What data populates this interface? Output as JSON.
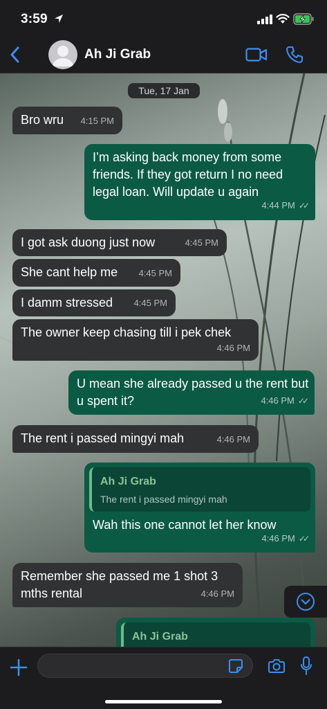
{
  "status_bar": {
    "time": "3:59"
  },
  "header": {
    "back_icon": "chevron-left-icon",
    "contact_name": "Ah Ji Grab",
    "video_icon": "video-camera-icon",
    "call_icon": "phone-icon"
  },
  "chat": {
    "date_label": "Tue, 17 Jan",
    "messages": [
      {
        "direction": "in",
        "text": "Bro wru",
        "time": "4:15 PM"
      },
      {
        "direction": "out",
        "text": "I’m asking back money from some friends. If they got return I no need legal loan. Will update u again",
        "time": "4:44 PM",
        "status": "read"
      },
      {
        "direction": "in",
        "text": "I got ask duong just now",
        "time": "4:45 PM"
      },
      {
        "direction": "in",
        "text": "She cant help me",
        "time": "4:45 PM"
      },
      {
        "direction": "in",
        "text": "I damm stressed",
        "time": "4:45 PM"
      },
      {
        "direction": "in",
        "text": "The owner keep chasing till i pek chek",
        "time": "4:46 PM"
      },
      {
        "direction": "out",
        "text": "U mean she already passed u the rent but u spent it?",
        "time": "4:46 PM",
        "status": "read"
      },
      {
        "direction": "in",
        "text": "The rent i passed mingyi mah",
        "time": "4:46 PM"
      },
      {
        "direction": "out",
        "text": "Wah this one cannot let her know",
        "time": "4:46 PM",
        "status": "read",
        "quote": {
          "name": "Ah Ji Grab",
          "text": "The rent i passed mingyi mah"
        }
      },
      {
        "direction": "in",
        "text": "Remember she passed me 1 shot 3 mths rental",
        "time": "4:46 PM"
      },
      {
        "direction": "out",
        "text": "",
        "quote": {
          "name": "Ah Ji Grab",
          "text": ""
        }
      }
    ]
  },
  "composer": {
    "value": "",
    "placeholder": ""
  },
  "colors": {
    "incoming_bubble": "#313233",
    "outgoing_bubble": "#0b5a44",
    "accent": "#3d8ef0",
    "quote_name": "#8fc29a"
  }
}
